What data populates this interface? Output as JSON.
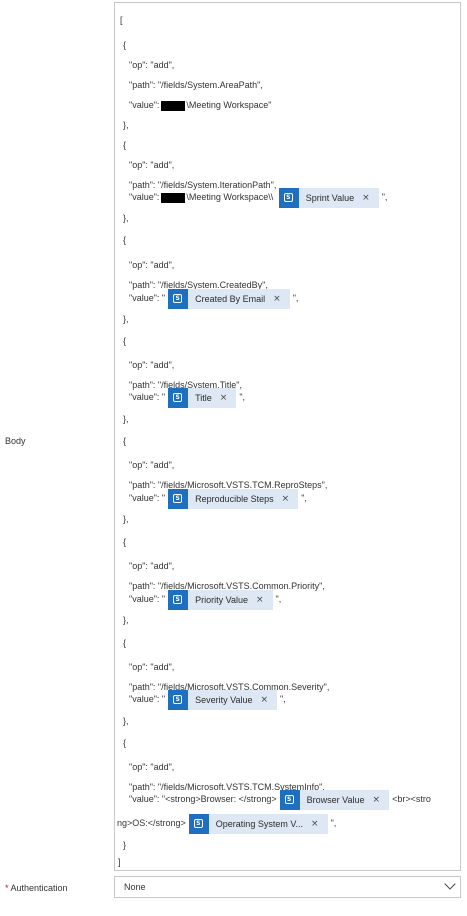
{
  "body_label": "Body",
  "auth_label": "Authentication",
  "auth_required_marker": "*",
  "auth_value": "None",
  "token_close": "×",
  "token_icon_text": "S",
  "tokens": {
    "sprint": "Sprint Value",
    "created_by": "Created By Email",
    "title": "Title",
    "repro": "Reproducible Steps",
    "priority": "Priority Value",
    "severity": "Severity Value",
    "browser": "Browser Value",
    "os": "Operating System V..."
  },
  "lines": {
    "l1": "[",
    "l2": "{",
    "l3": "\"op\": \"add\",",
    "l4": "\"path\": \"/fields/System.AreaPath\",",
    "l5a": "\"value\":",
    "l5b": "\\Meeting Workspace\"",
    "l6": "},",
    "l7": "{",
    "l8": "\"op\": \"add\",",
    "l9": "\"path\": \"/fields/System.IterationPath\",",
    "l10a": "\"value\":",
    "l10b": "\\Meeting Workspace\\\\",
    "l10c": "\",",
    "l11": "},",
    "l12": "{",
    "l13": "\"op\": \"add\",",
    "l14": "\"path\": \"/fields/System.CreatedBy\",",
    "l15a": "\"value\": \"",
    "l15c": "\",",
    "l16": "},",
    "l17": "{",
    "l18": "\"op\": \"add\",",
    "l19": "\"path\": \"/fields/System.Title\",",
    "l20a": "\"value\": \"",
    "l20c": "\",",
    "l21": "},",
    "l22": "{",
    "l23": "\"op\": \"add\",",
    "l24": "\"path\": \"/fields/Microsoft.VSTS.TCM.ReproSteps\",",
    "l25a": "\"value\": \"",
    "l25c": "\",",
    "l26": "},",
    "l27": "{",
    "l28": "\"op\": \"add\",",
    "l29": "\"path\": \"/fields/Microsoft.VSTS.Common.Priority\",",
    "l30a": "\"value\": \"",
    "l30c": "\",",
    "l31": "},",
    "l32": "{",
    "l33": "\"op\": \"add\",",
    "l34": "\"path\": \"/fields/Microsoft.VSTS.Common.Severity\",",
    "l35a": "\"value\": \"",
    "l35c": "\",",
    "l36": "},",
    "l37": "{",
    "l38": "\"op\": \"add\",",
    "l39": "\"path\": \"/fields/Microsoft.VSTS.TCM.SystemInfo\",",
    "l40a": "\"value\": \"<strong>Browser: </strong>",
    "l40c": "<br><stro",
    "l41a": "ng>OS:</strong>",
    "l41c": "\",",
    "l42": "}",
    "l43": "]"
  },
  "colors": {
    "token_bg": "#dee8f5",
    "token_icon": "#1e6fc0",
    "required": "#a4262c"
  }
}
